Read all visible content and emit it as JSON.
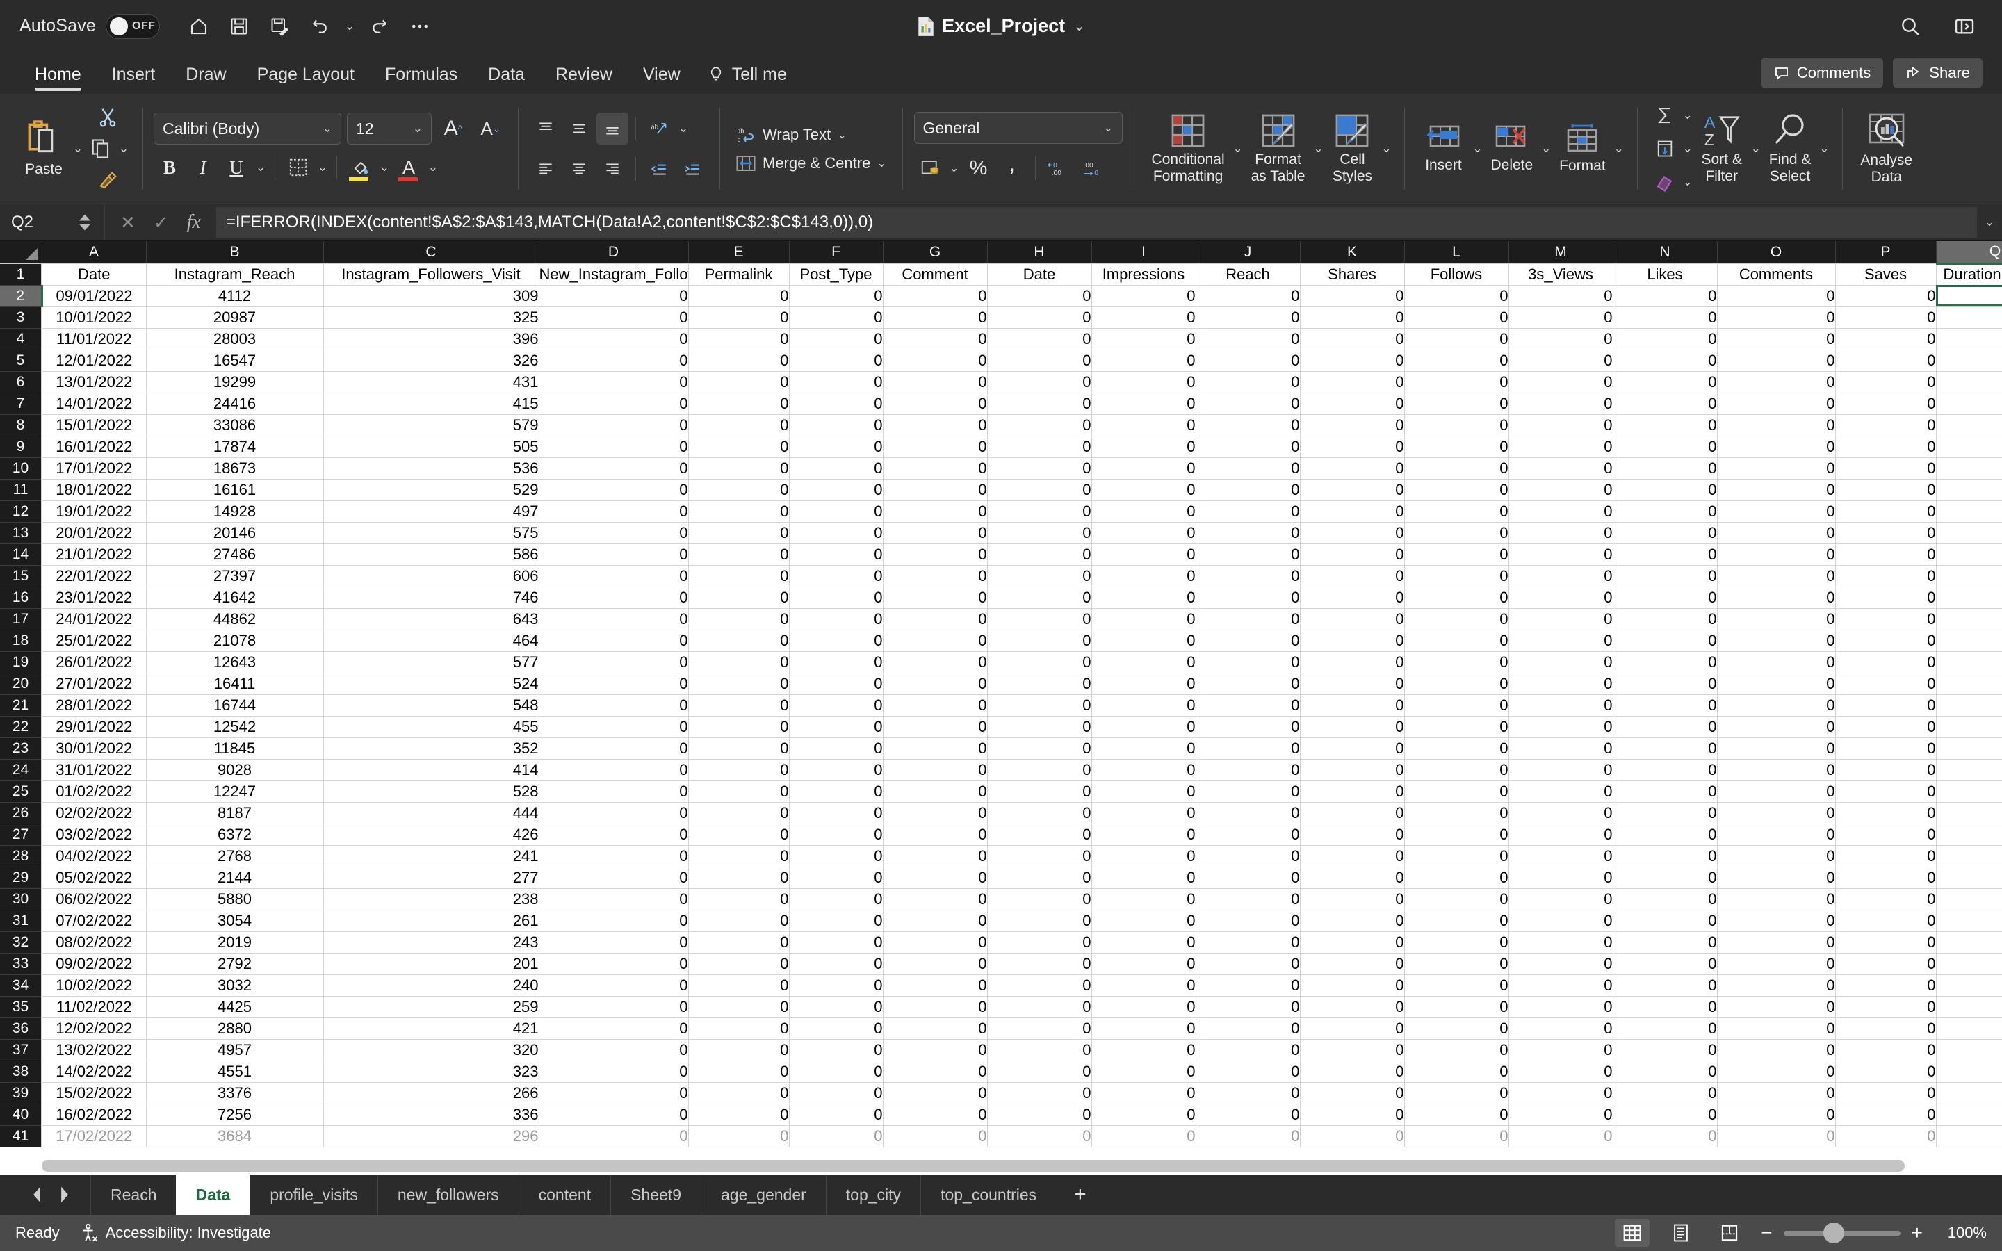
{
  "titlebar": {
    "autosave_label": "AutoSave",
    "autosave_state": "OFF",
    "document_title": "Excel_Project",
    "quick_access": [
      "home-icon",
      "save-icon",
      "save-as-icon",
      "undo-icon",
      "redo-icon",
      "more-icon"
    ],
    "search_icon": "search-icon",
    "sidebar_icon": "ribbon-display-icon"
  },
  "ribbon_tabs": {
    "items": [
      "Home",
      "Insert",
      "Draw",
      "Page Layout",
      "Formulas",
      "Data",
      "Review",
      "View"
    ],
    "active": "Home",
    "tell_me": "Tell me",
    "comments": "Comments",
    "share": "Share"
  },
  "ribbon": {
    "clipboard": {
      "paste": "Paste"
    },
    "font": {
      "family": "Calibri (Body)",
      "size": "12",
      "grow_label": "A",
      "shrink_label": "A",
      "bold": "B",
      "italic": "I",
      "underline": "U"
    },
    "alignment": {
      "wrap_text": "Wrap Text",
      "merge_centre": "Merge & Centre"
    },
    "number": {
      "format": "General",
      "percent": "%",
      "comma": ",",
      "increase_decimal": ".00",
      "decrease_decimal": ".00"
    },
    "styles": {
      "conditional_formatting": "Conditional\nFormatting",
      "conditional_formatting_l1": "Conditional",
      "conditional_formatting_l2": "Formatting",
      "format_as_table_l1": "Format",
      "format_as_table_l2": "as Table",
      "cell_styles_l1": "Cell",
      "cell_styles_l2": "Styles"
    },
    "cells": {
      "insert": "Insert",
      "delete": "Delete",
      "format": "Format"
    },
    "editing": {
      "sort_filter_l1": "Sort &",
      "sort_filter_l2": "Filter",
      "find_select_l1": "Find &",
      "find_select_l2": "Select"
    },
    "analysis": {
      "analyse_data_l1": "Analyse",
      "analyse_data_l2": "Data"
    }
  },
  "formula_bar": {
    "name_box": "Q2",
    "cancel_icon": "cancel-icon",
    "enter_icon": "confirm-icon",
    "fx_icon": "function-icon",
    "formula": "=IFERROR(INDEX(content!$A$2:$A$143,MATCH(Data!A2,content!$C$2:$C$143,0)),0)"
  },
  "grid": {
    "columns": [
      "A",
      "B",
      "C",
      "D",
      "E",
      "F",
      "G",
      "H",
      "I",
      "J",
      "K",
      "L",
      "M",
      "N",
      "O",
      "P",
      "Q"
    ],
    "selected_column": "Q",
    "selected_row": 2,
    "selected_cell": "Q2",
    "headers": [
      "Date",
      "Instagram_Reach",
      "Instagram_Followers_Visit",
      "New_Instagram_Followers",
      "Permalink",
      "Post_Type",
      "Comment",
      "Date",
      "Impressions",
      "Reach",
      "Shares",
      "Follows",
      "3s_Views",
      "Likes",
      "Comments",
      "Saves",
      "Duration (secs)"
    ],
    "rows": [
      {
        "n": 2,
        "date": "09/01/2022",
        "reach": "4112",
        "visits": "309"
      },
      {
        "n": 3,
        "date": "10/01/2022",
        "reach": "20987",
        "visits": "325"
      },
      {
        "n": 4,
        "date": "11/01/2022",
        "reach": "28003",
        "visits": "396"
      },
      {
        "n": 5,
        "date": "12/01/2022",
        "reach": "16547",
        "visits": "326"
      },
      {
        "n": 6,
        "date": "13/01/2022",
        "reach": "19299",
        "visits": "431"
      },
      {
        "n": 7,
        "date": "14/01/2022",
        "reach": "24416",
        "visits": "415"
      },
      {
        "n": 8,
        "date": "15/01/2022",
        "reach": "33086",
        "visits": "579"
      },
      {
        "n": 9,
        "date": "16/01/2022",
        "reach": "17874",
        "visits": "505"
      },
      {
        "n": 10,
        "date": "17/01/2022",
        "reach": "18673",
        "visits": "536"
      },
      {
        "n": 11,
        "date": "18/01/2022",
        "reach": "16161",
        "visits": "529"
      },
      {
        "n": 12,
        "date": "19/01/2022",
        "reach": "14928",
        "visits": "497"
      },
      {
        "n": 13,
        "date": "20/01/2022",
        "reach": "20146",
        "visits": "575"
      },
      {
        "n": 14,
        "date": "21/01/2022",
        "reach": "27486",
        "visits": "586"
      },
      {
        "n": 15,
        "date": "22/01/2022",
        "reach": "27397",
        "visits": "606"
      },
      {
        "n": 16,
        "date": "23/01/2022",
        "reach": "41642",
        "visits": "746"
      },
      {
        "n": 17,
        "date": "24/01/2022",
        "reach": "44862",
        "visits": "643"
      },
      {
        "n": 18,
        "date": "25/01/2022",
        "reach": "21078",
        "visits": "464"
      },
      {
        "n": 19,
        "date": "26/01/2022",
        "reach": "12643",
        "visits": "577"
      },
      {
        "n": 20,
        "date": "27/01/2022",
        "reach": "16411",
        "visits": "524"
      },
      {
        "n": 21,
        "date": "28/01/2022",
        "reach": "16744",
        "visits": "548"
      },
      {
        "n": 22,
        "date": "29/01/2022",
        "reach": "12542",
        "visits": "455"
      },
      {
        "n": 23,
        "date": "30/01/2022",
        "reach": "11845",
        "visits": "352"
      },
      {
        "n": 24,
        "date": "31/01/2022",
        "reach": "9028",
        "visits": "414"
      },
      {
        "n": 25,
        "date": "01/02/2022",
        "reach": "12247",
        "visits": "528"
      },
      {
        "n": 26,
        "date": "02/02/2022",
        "reach": "8187",
        "visits": "444"
      },
      {
        "n": 27,
        "date": "03/02/2022",
        "reach": "6372",
        "visits": "426"
      },
      {
        "n": 28,
        "date": "04/02/2022",
        "reach": "2768",
        "visits": "241"
      },
      {
        "n": 29,
        "date": "05/02/2022",
        "reach": "2144",
        "visits": "277"
      },
      {
        "n": 30,
        "date": "06/02/2022",
        "reach": "5880",
        "visits": "238"
      },
      {
        "n": 31,
        "date": "07/02/2022",
        "reach": "3054",
        "visits": "261"
      },
      {
        "n": 32,
        "date": "08/02/2022",
        "reach": "2019",
        "visits": "243"
      },
      {
        "n": 33,
        "date": "09/02/2022",
        "reach": "2792",
        "visits": "201"
      },
      {
        "n": 34,
        "date": "10/02/2022",
        "reach": "3032",
        "visits": "240"
      },
      {
        "n": 35,
        "date": "11/02/2022",
        "reach": "4425",
        "visits": "259"
      },
      {
        "n": 36,
        "date": "12/02/2022",
        "reach": "2880",
        "visits": "421"
      },
      {
        "n": 37,
        "date": "13/02/2022",
        "reach": "4957",
        "visits": "320"
      },
      {
        "n": 38,
        "date": "14/02/2022",
        "reach": "4551",
        "visits": "323"
      },
      {
        "n": 39,
        "date": "15/02/2022",
        "reach": "3376",
        "visits": "266"
      },
      {
        "n": 40,
        "date": "16/02/2022",
        "reach": "7256",
        "visits": "336"
      },
      {
        "n": 41,
        "date": "17/02/2022",
        "reach": "3684",
        "visits": "296"
      }
    ],
    "zero_value": "0"
  },
  "sheet_tabs": {
    "items": [
      "Reach",
      "Data",
      "profile_visits",
      "new_followers",
      "content",
      "Sheet9",
      "age_gender",
      "top_city",
      "top_countries"
    ],
    "active": "Data",
    "add_label": "+"
  },
  "status_bar": {
    "state": "Ready",
    "accessibility": "Accessibility: Investigate",
    "views": [
      "normal-view-icon",
      "page-layout-icon",
      "page-break-icon"
    ],
    "active_view": "normal-view-icon",
    "zoom_out": "−",
    "zoom_in": "+",
    "zoom_level": "100%"
  }
}
